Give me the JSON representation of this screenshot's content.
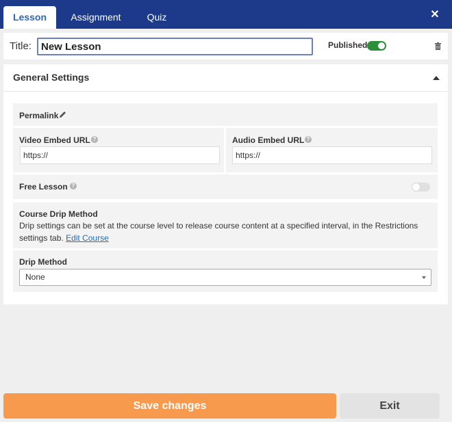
{
  "tabs": [
    {
      "label": "Lesson",
      "active": true
    },
    {
      "label": "Assignment",
      "active": false
    },
    {
      "label": "Quiz",
      "active": false
    }
  ],
  "close_icon": "close-icon",
  "title_row": {
    "label": "Title:",
    "value": "New Lesson",
    "published_label": "Published",
    "published": true
  },
  "panel": {
    "title": "General Settings",
    "permalink_label": "Permalink",
    "video": {
      "label": "Video Embed URL",
      "value": "https://"
    },
    "audio": {
      "label": "Audio Embed URL",
      "value": "https://"
    },
    "free_lesson": {
      "label": "Free Lesson",
      "enabled": false
    },
    "drip": {
      "heading": "Course Drip Method",
      "desc_line1": "Drip settings can be set at the course level to release course content at a specified interval, in the Restrictions",
      "desc_line2": "settings tab.",
      "link": "Edit Course"
    },
    "drip_method": {
      "label": "Drip Method",
      "selected": "None"
    }
  },
  "buttons": {
    "save": "Save changes",
    "exit": "Exit"
  },
  "colors": {
    "topbar": "#1d3a8a",
    "save": "#f79a4e",
    "toggle_on": "#2e8f3a",
    "link": "#1f6fb2"
  }
}
